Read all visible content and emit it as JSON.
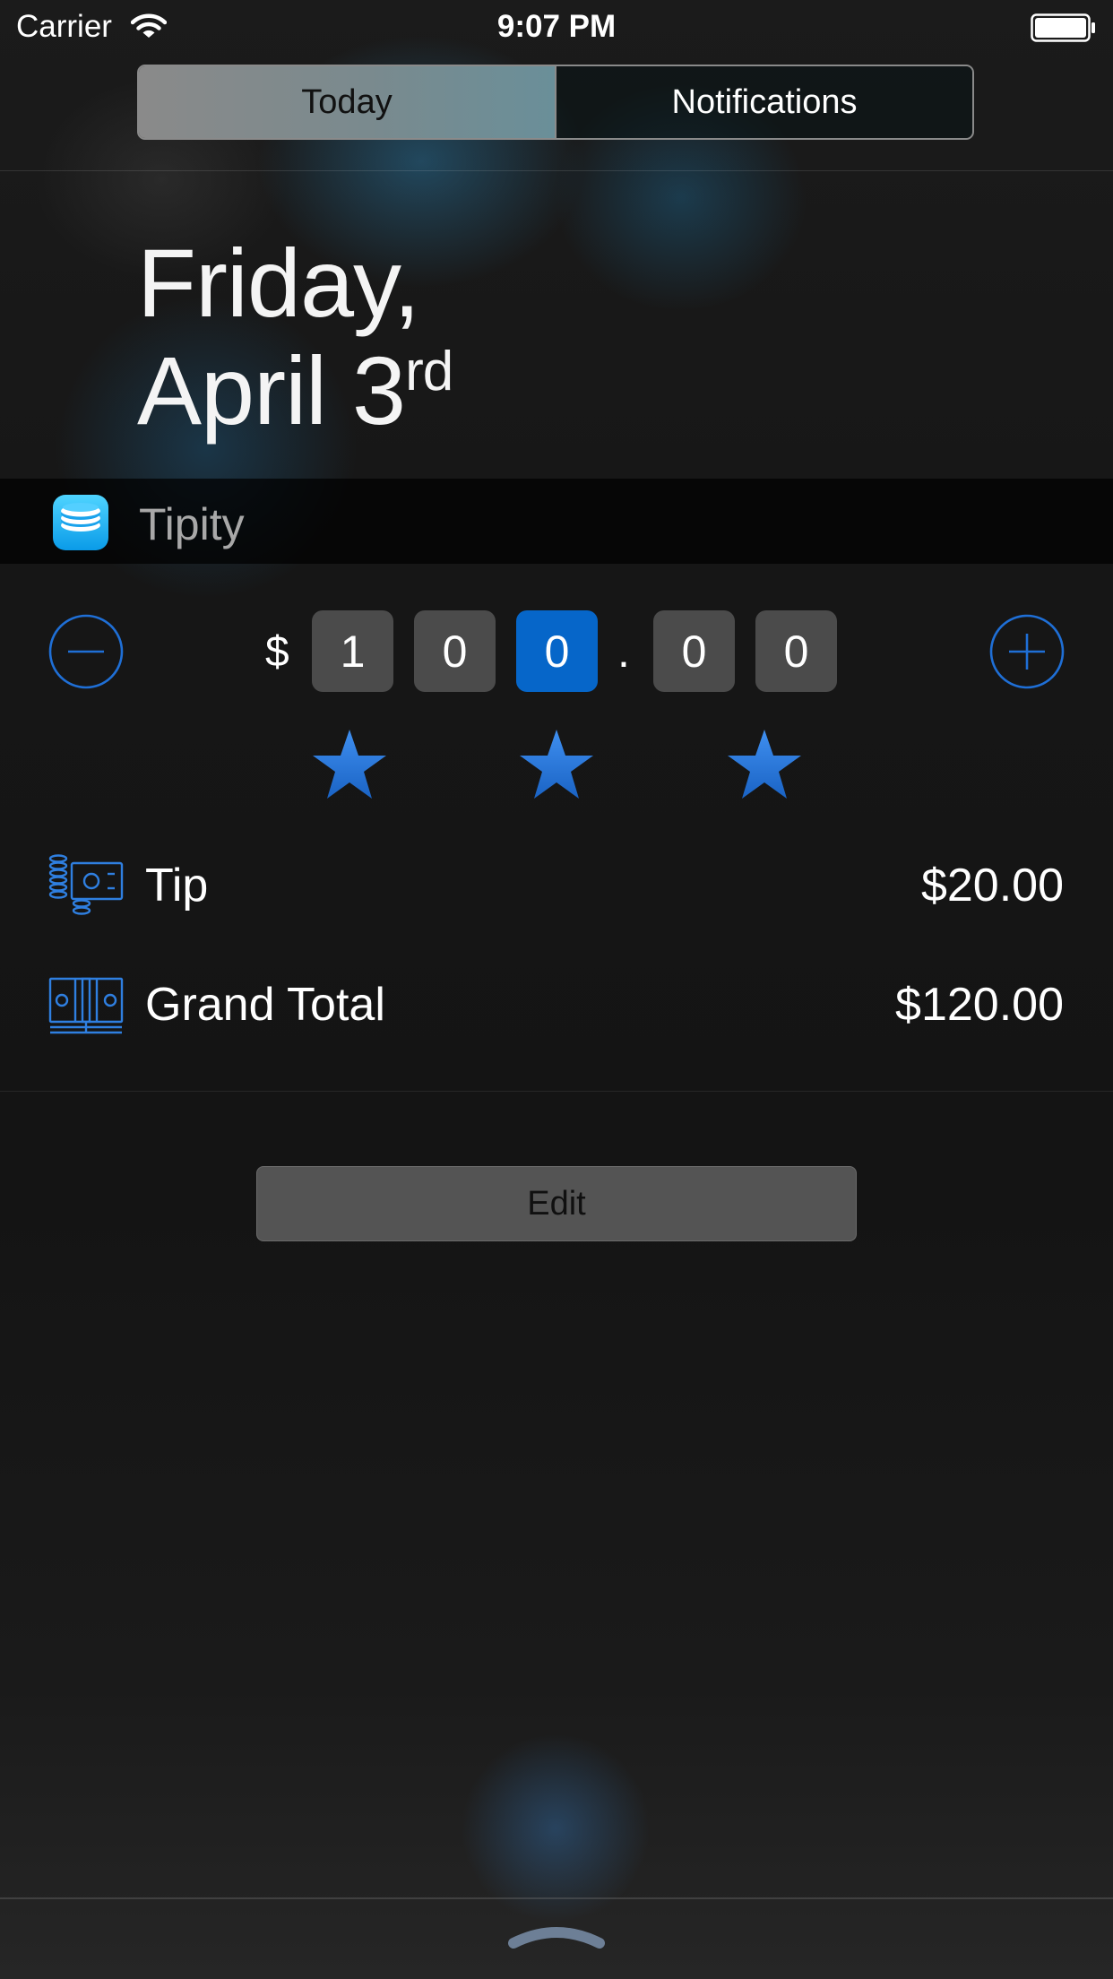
{
  "status_bar": {
    "carrier": "Carrier",
    "time": "9:07 PM"
  },
  "tabs": [
    {
      "label": "Today",
      "selected": true
    },
    {
      "label": "Notifications",
      "selected": false
    }
  ],
  "date": {
    "line1": "Friday,",
    "line2": "April 3",
    "suffix": "rd"
  },
  "widget": {
    "app_name": "Tipity",
    "currency_symbol": "$",
    "digits": [
      "1",
      "0",
      "0",
      "0",
      "0"
    ],
    "decimal_separator": ".",
    "selected_digit_index": 2,
    "rating": {
      "value": 3,
      "max": 3
    },
    "tip": {
      "label": "Tip",
      "value": "$20.00"
    },
    "grand_total": {
      "label": "Grand Total",
      "value": "$120.00"
    }
  },
  "edit_button": {
    "label": "Edit"
  },
  "colors": {
    "accent": "#1f6fd6",
    "selected_digit": "#0666c9",
    "digit_box": "#4b4b4b",
    "background": "#151515"
  },
  "icons": {
    "minus": "minus-circle-icon",
    "plus": "plus-circle-icon",
    "star": "star-icon",
    "tip": "coins-cash-icon",
    "grand_total": "banknotes-icon"
  }
}
